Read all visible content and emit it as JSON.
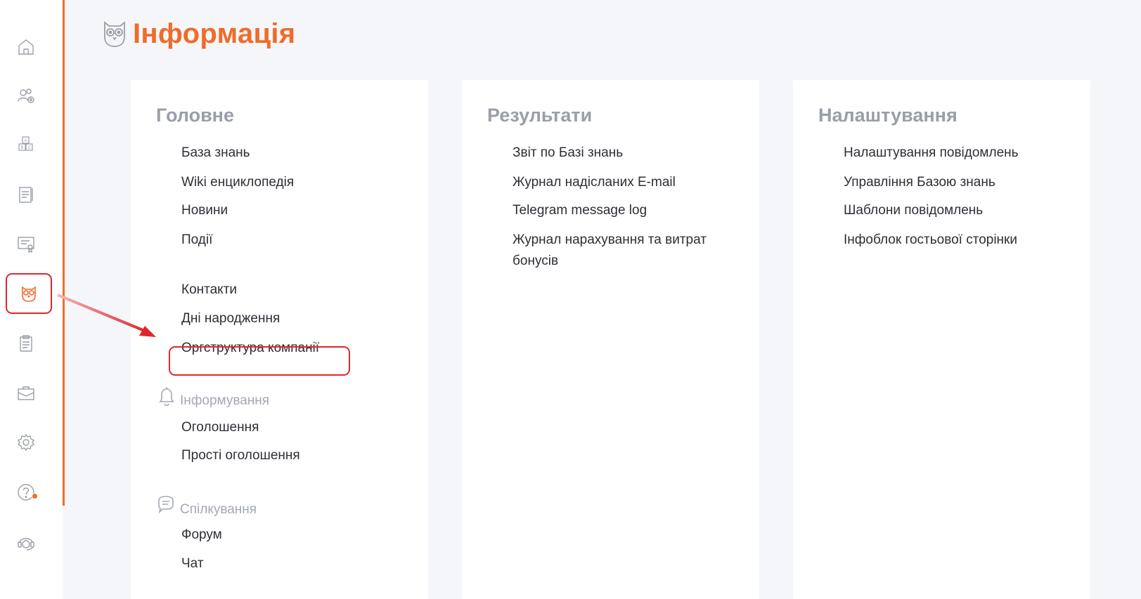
{
  "sidebar": {
    "icons": [
      "home-icon",
      "users-gear-icon",
      "abc-blocks-icon",
      "notebook-icon",
      "certificate-icon",
      "owl-icon",
      "clipboard-icon",
      "briefcase-icon",
      "gear-icon",
      "question-icon",
      "support-headset-icon"
    ],
    "active": "owl-icon"
  },
  "header": {
    "title": "Інформація"
  },
  "columns": {
    "main": {
      "title": "Головне",
      "links": [
        "База знань",
        "Wiki енциклопедія",
        "Новини",
        "Події"
      ],
      "links2": [
        "Контакти",
        "Дні народження",
        "Оргструктура компанії"
      ],
      "informing": {
        "label": "Інформування",
        "links": [
          "Оголошення",
          "Прості оголошення"
        ]
      },
      "communication": {
        "label": "Спілкування",
        "links": [
          "Форум",
          "Чат"
        ]
      }
    },
    "results": {
      "title": "Результати",
      "links": [
        "Звіт по Базі знань",
        "Журнал надісланих E-mail",
        "Telegram message log",
        "Журнал нарахування та витрат бонусів"
      ]
    },
    "settings": {
      "title": "Налаштування",
      "links": [
        "Налаштування повідомлень",
        "Управління Базою знань",
        "Шаблони повідомлень",
        "Інфоблок гостьової сторінки"
      ]
    }
  },
  "colors": {
    "accent": "#ef6c2a",
    "highlight": "#e0262d",
    "muted": "#9a9ea8",
    "text": "#2d2f36"
  }
}
